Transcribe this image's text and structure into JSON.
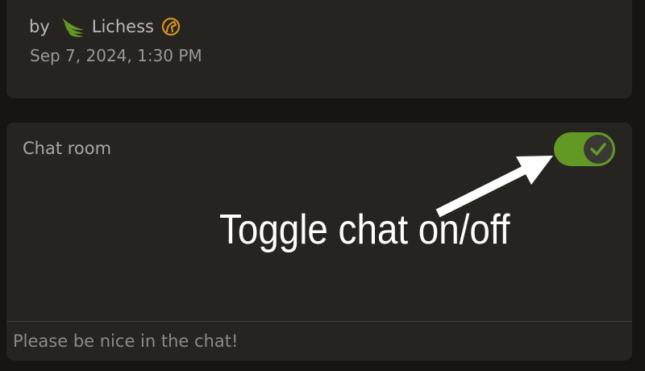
{
  "author": {
    "by_label": "by",
    "username": "Lichess",
    "date": "Sep 7, 2024, 1:30 PM",
    "icon": "wing-icon",
    "badge_icon": "patron-horse-icon"
  },
  "chat": {
    "title": "Chat room",
    "toggle_on": true,
    "input_placeholder": "Please be nice in the chat!"
  },
  "annotation": {
    "text": "Toggle chat on/off"
  },
  "colors": {
    "background": "#161512",
    "card": "#262421",
    "toggle_on": "#629924",
    "username_icon": "#629924",
    "patron_icon": "#d59120"
  }
}
